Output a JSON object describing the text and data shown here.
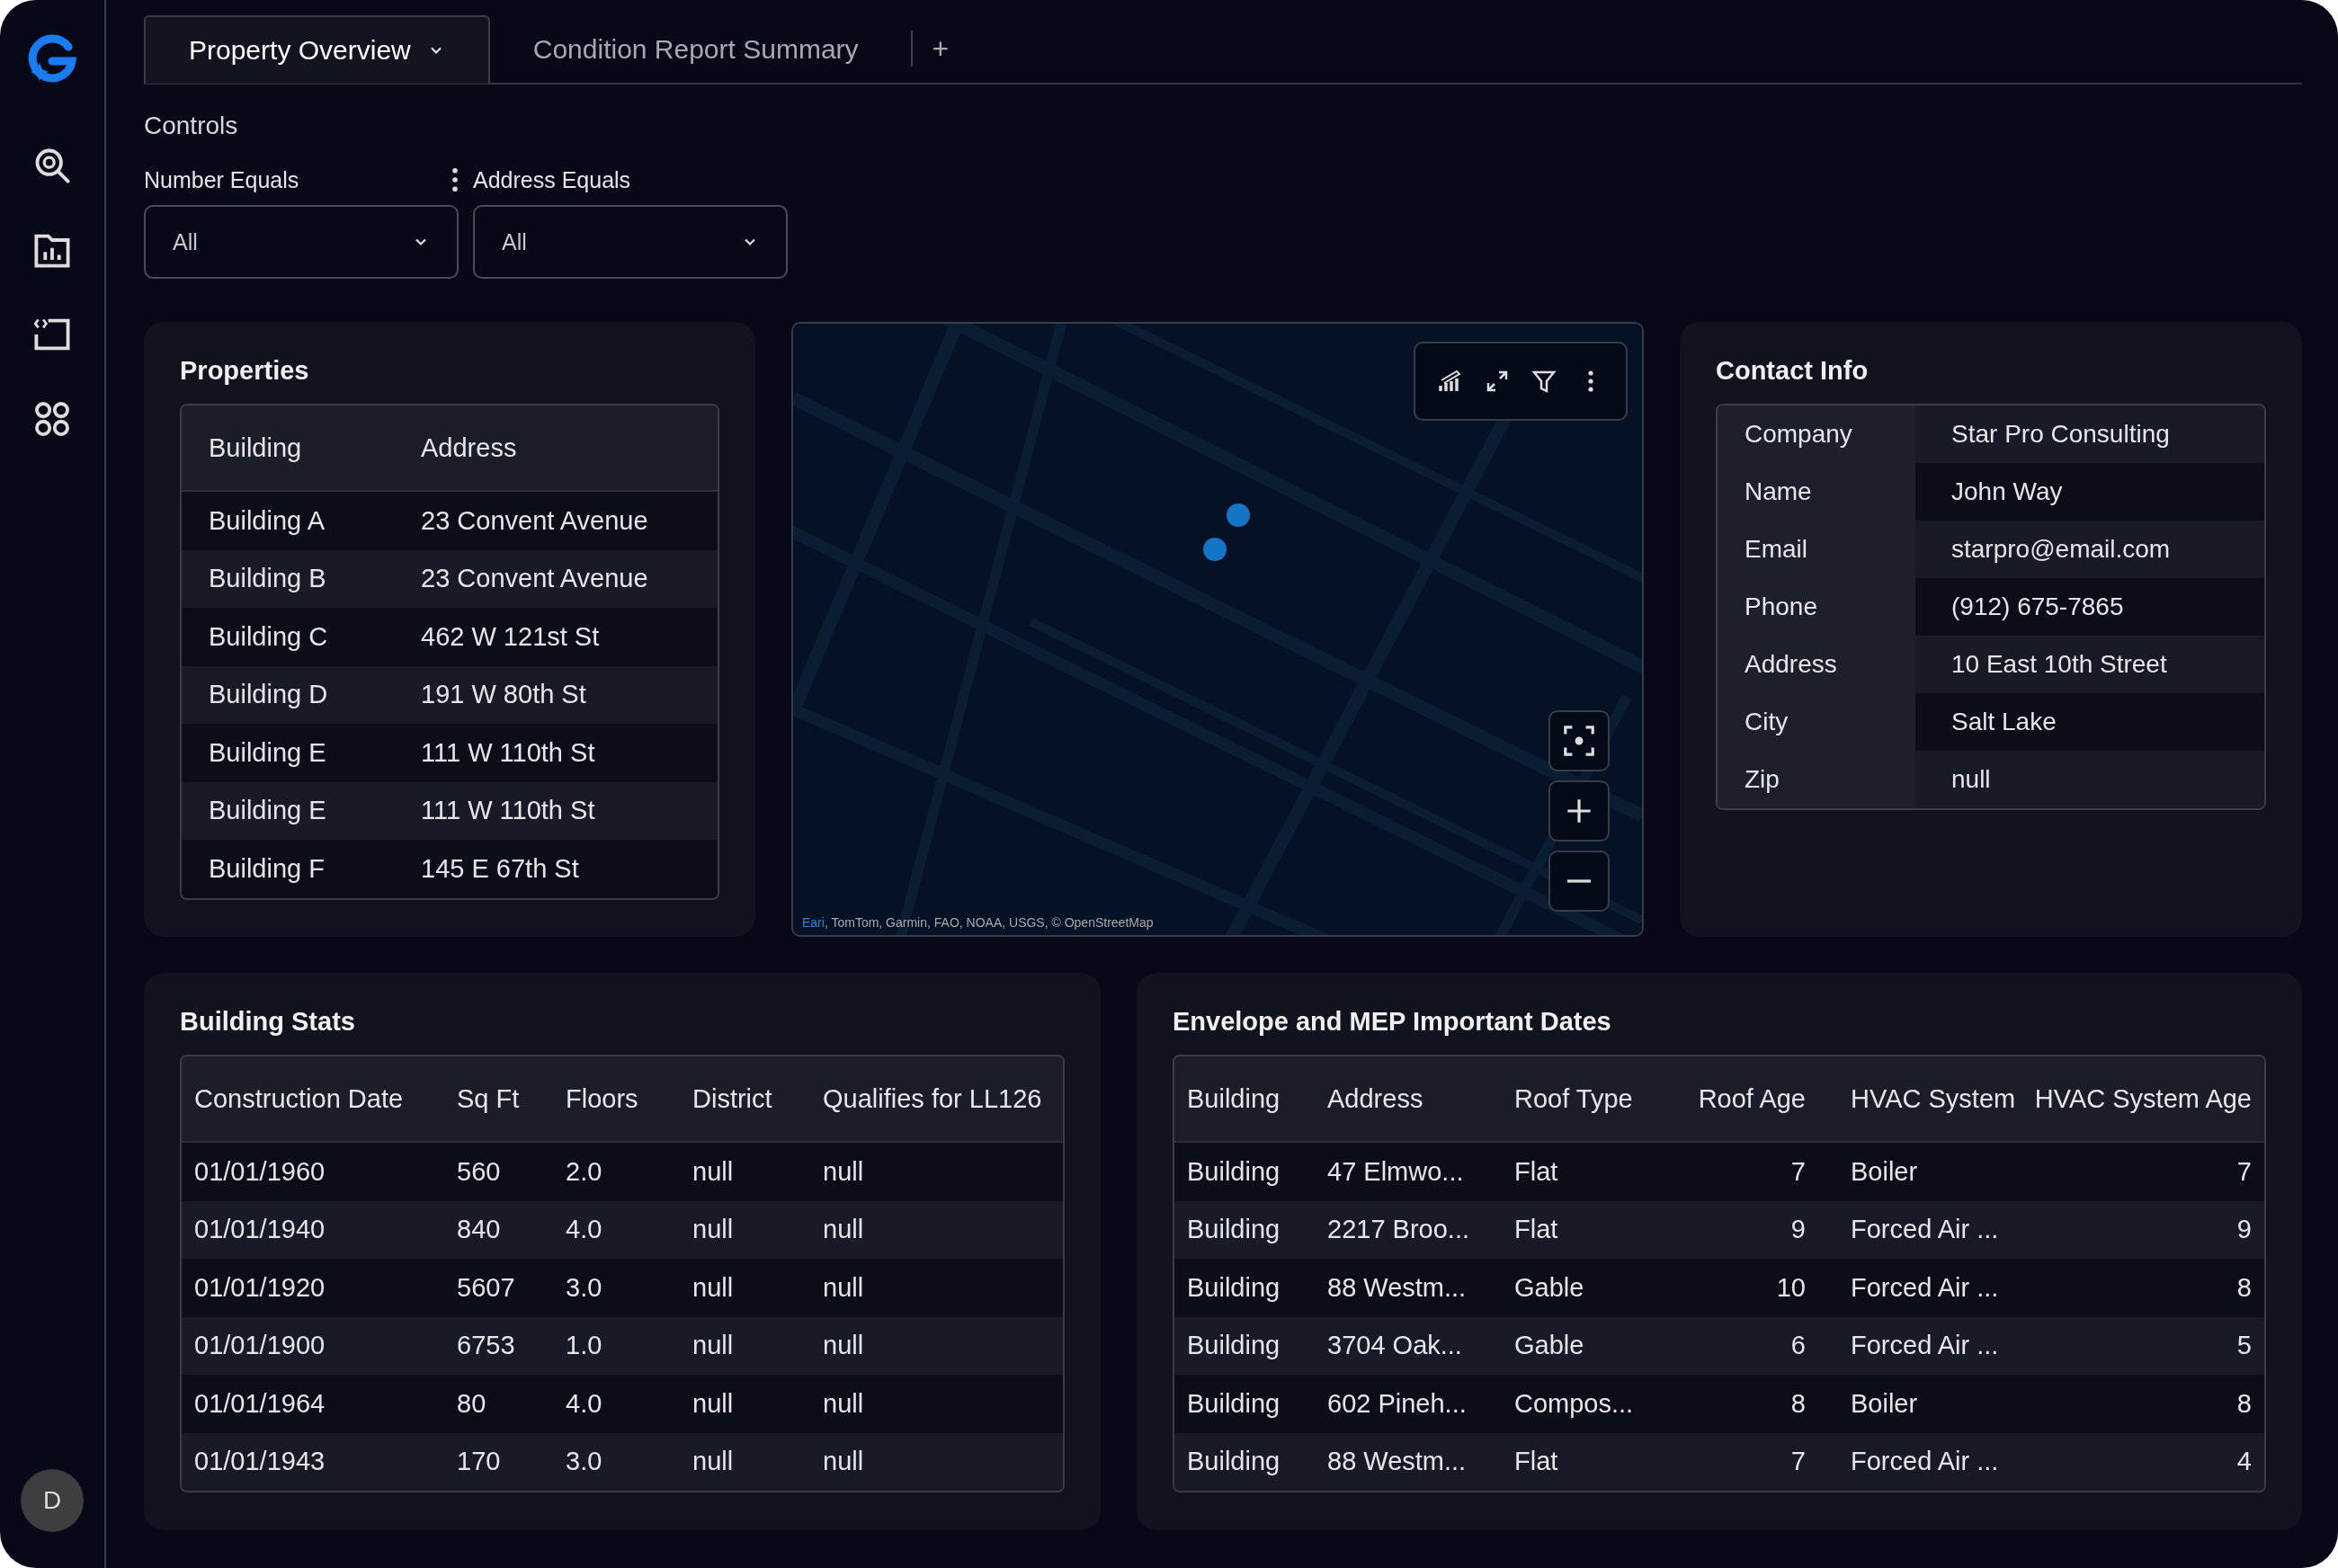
{
  "sidebar": {
    "avatar": "D"
  },
  "tabs": [
    {
      "label": "Property Overview",
      "selected": true,
      "has_menu": true
    },
    {
      "label": "Condition Report Summary",
      "selected": false,
      "has_menu": false
    }
  ],
  "add_tab": "+",
  "controls": {
    "title": "Controls",
    "filters": [
      {
        "label": "Number Equals",
        "value": "All",
        "has_menu": true
      },
      {
        "label": "Address Equals",
        "value": "All",
        "has_menu": false
      }
    ]
  },
  "properties": {
    "title": "Properties",
    "columns": [
      "Building",
      "Address"
    ],
    "rows": [
      [
        "Building A",
        "23 Convent Avenue"
      ],
      [
        "Building B",
        "23 Convent Avenue"
      ],
      [
        "Building C",
        "462 W 121st St"
      ],
      [
        "Building D",
        "191 W 80th St"
      ],
      [
        "Building E",
        "111 W 110th St"
      ],
      [
        "Building E",
        "111 W 110th St"
      ],
      [
        "Building F",
        "145 E 67th St"
      ]
    ]
  },
  "map": {
    "attribution_source": "Eari",
    "attribution": ", TomTom, Garmin, FAO, NOAA, USGS, © OpenStreetMap"
  },
  "contact": {
    "title": "Contact Info",
    "rows": [
      {
        "key": "Company",
        "value": "Star Pro Consulting"
      },
      {
        "key": "Name",
        "value": "John Way"
      },
      {
        "key": "Email",
        "value": "starpro@email.com"
      },
      {
        "key": "Phone",
        "value": "(912) 675-7865"
      },
      {
        "key": "Address",
        "value": "10 East 10th Street"
      },
      {
        "key": "City",
        "value": "Salt Lake"
      },
      {
        "key": "Zip",
        "value": "null"
      }
    ]
  },
  "building_stats": {
    "title": "Building Stats",
    "columns": [
      "Construction Date",
      "Sq Ft",
      "Floors",
      "District",
      "Qualifies for LL126"
    ],
    "rows": [
      [
        "01/01/1960",
        "560",
        "2.0",
        "null",
        "null"
      ],
      [
        "01/01/1940",
        "840",
        "4.0",
        "null",
        "null"
      ],
      [
        "01/01/1920",
        "5607",
        "3.0",
        "null",
        "null"
      ],
      [
        "01/01/1900",
        "6753",
        "1.0",
        "null",
        "null"
      ],
      [
        "01/01/1964",
        "80",
        "4.0",
        "null",
        "null"
      ],
      [
        "01/01/1943",
        "170",
        "3.0",
        "null",
        "null"
      ]
    ]
  },
  "envelope": {
    "title": "Envelope and MEP Important Dates",
    "columns": [
      {
        "label": "Building",
        "kind": "text"
      },
      {
        "label": "Address",
        "kind": "text"
      },
      {
        "label": "Roof Type",
        "kind": "text"
      },
      {
        "label": "Roof Age",
        "kind": "number"
      },
      {
        "label": "HVAC System",
        "kind": "text"
      },
      {
        "label": "HVAC System Age",
        "kind": "number"
      }
    ],
    "rows": [
      [
        "Building",
        "47 Elmwo...",
        "Flat",
        "7",
        "Boiler",
        "7"
      ],
      [
        "Building",
        "2217 Broo...",
        "Flat",
        "9",
        "Forced Air ...",
        "9"
      ],
      [
        "Building",
        "88 Westm...",
        "Gable",
        "10",
        "Forced Air ...",
        "8"
      ],
      [
        "Building",
        "3704 Oak...",
        "Gable",
        "6",
        "Forced Air ...",
        "5"
      ],
      [
        "Building",
        "602 Pineh...",
        "Compos...",
        "8",
        "Boiler",
        "8"
      ],
      [
        "Building",
        "88 Westm...",
        "Flat",
        "7",
        "Forced Air ...",
        "4"
      ]
    ]
  }
}
